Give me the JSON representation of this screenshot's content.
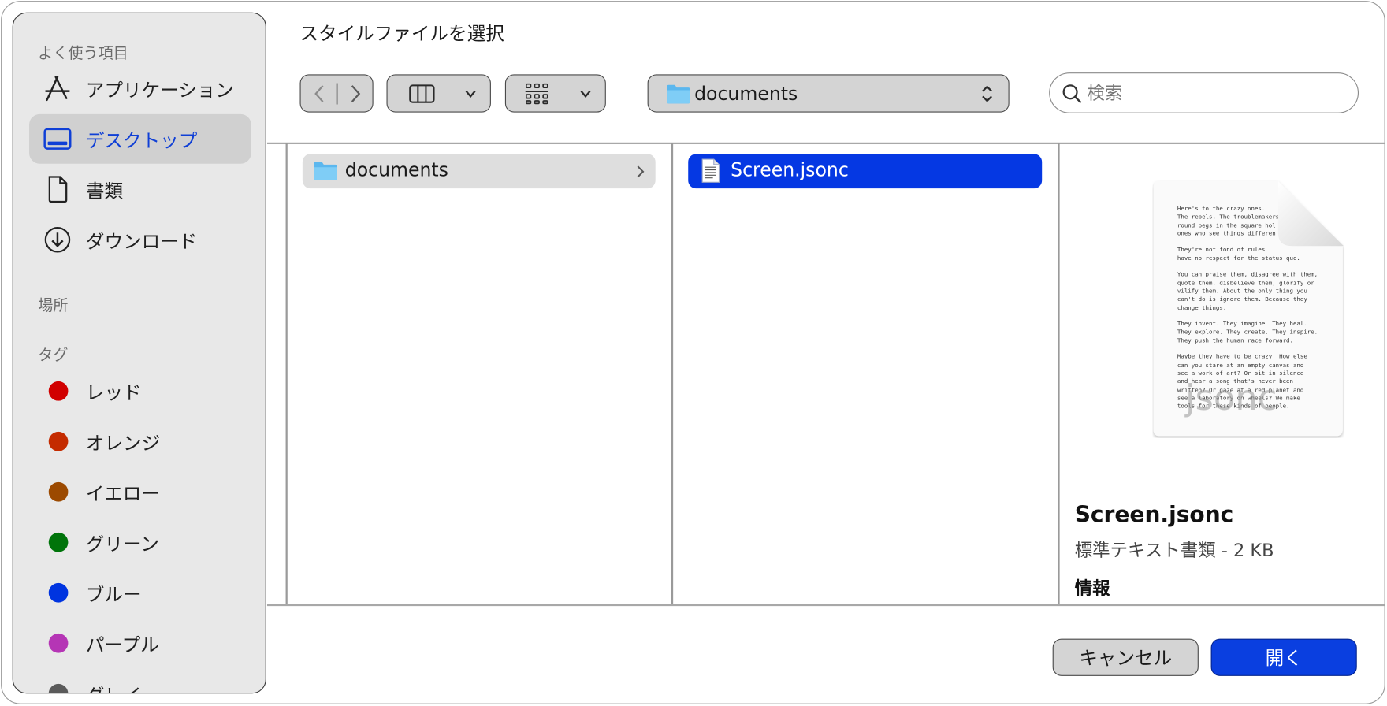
{
  "dialog": {
    "title": "スタイルファイルを選択"
  },
  "sidebar": {
    "favorites_header": "よく使う項目",
    "favorites": [
      {
        "label": "アプリケーション",
        "icon": "applications-icon"
      },
      {
        "label": "デスクトップ",
        "icon": "desktop-icon",
        "selected": true
      },
      {
        "label": "書類",
        "icon": "document-icon"
      },
      {
        "label": "ダウンロード",
        "icon": "download-icon"
      }
    ],
    "locations_header": "場所",
    "tags_header": "タグ",
    "tags": [
      {
        "label": "レッド",
        "color": "#d10000"
      },
      {
        "label": "オレンジ",
        "color": "#c42b00"
      },
      {
        "label": "イエロー",
        "color": "#9c4a00"
      },
      {
        "label": "グリーン",
        "color": "#00740a"
      },
      {
        "label": "ブルー",
        "color": "#0034e0"
      },
      {
        "label": "パープル",
        "color": "#b535b5"
      },
      {
        "label": "グレイ",
        "color": "#5a5a5a"
      }
    ]
  },
  "toolbar": {
    "path_label": "documents",
    "search_placeholder": "検索"
  },
  "browser": {
    "column1": [
      {
        "name": "documents",
        "icon": "folder-icon"
      }
    ],
    "column2": [
      {
        "name": "Screen.jsonc",
        "icon": "text-file-icon",
        "selected": true
      }
    ]
  },
  "preview": {
    "file_name": "Screen.jsonc",
    "kind_size": "標準テキスト書類 - 2 KB",
    "info_label": "情報",
    "thumbnail_ext": "jsonc",
    "thumbnail_text": "Here's to the crazy ones.\nThe rebels. The troublemakers\nround pegs in the square hol\nones who see things differen\n\nThey're not fond of rules.\nhave no respect for the status quo.\n\nYou can praise them, disagree with them,\nquote them, disbelieve them, glorify or\nvilify them. About the only thing you\ncan't do is ignore them. Because they\nchange things.\n\nThey invent. They imagine. They heal.\nThey explore. They create. They inspire.\nThey push the human race forward.\n\nMaybe they have to be crazy. How else\ncan you stare at an empty canvas and\nsee a work of art? Or sit in silence\nand hear a song that's never been\nwritten? Or gaze at a red planet and\nsee a laboratory on wheels? We make\ntools for these kinds of people."
  },
  "buttons": {
    "cancel": "キャンセル",
    "open": "開く"
  },
  "colors": {
    "accent": "#0a3fe0",
    "selection": "#0538e3"
  }
}
